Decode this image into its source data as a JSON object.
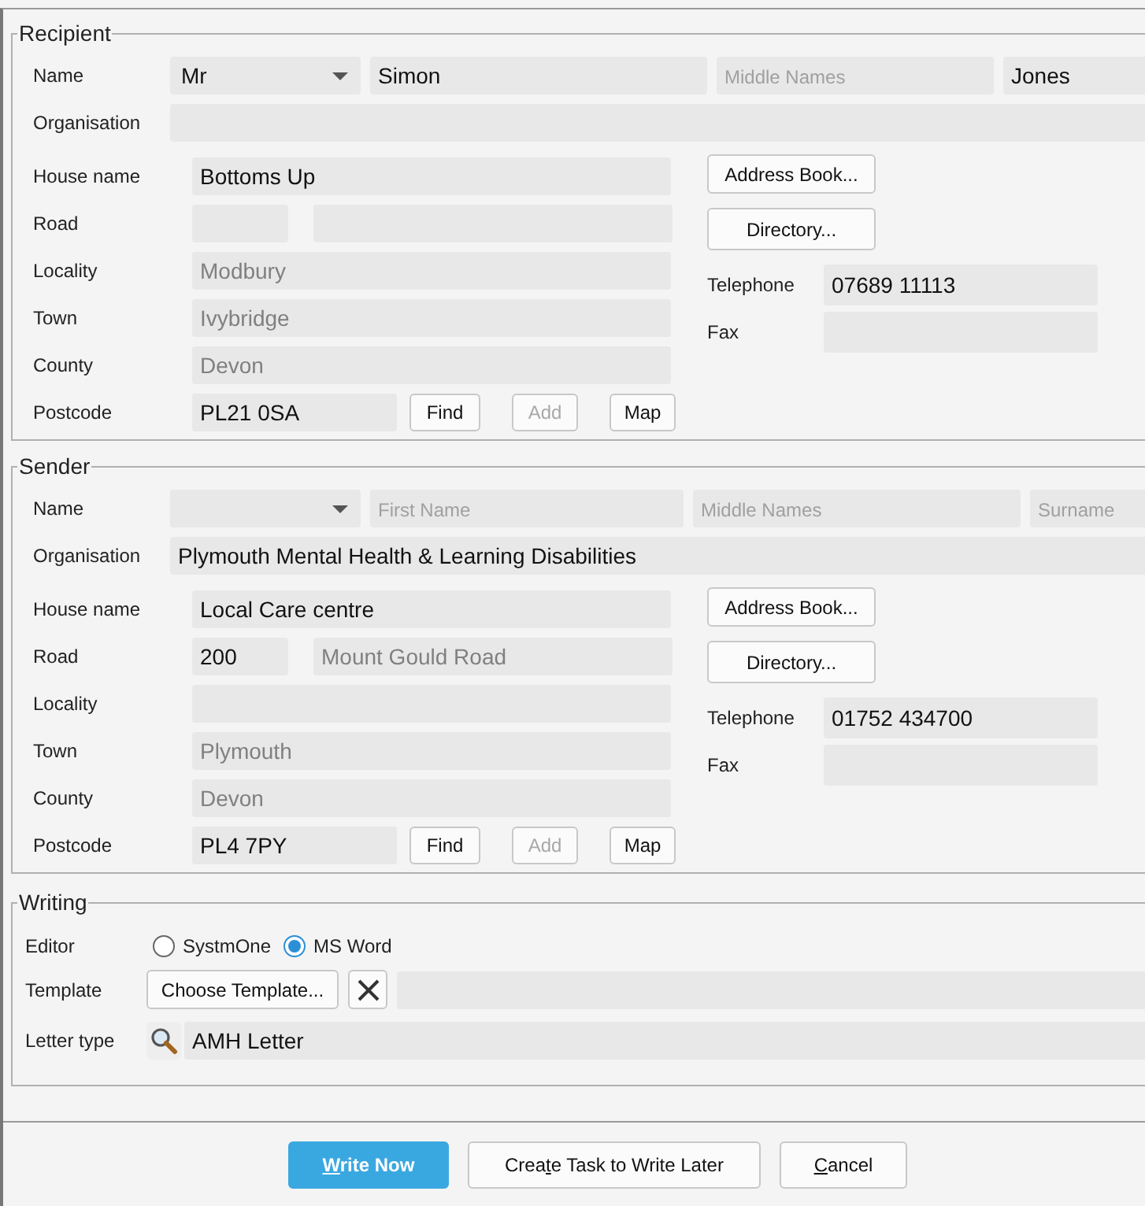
{
  "sections": [
    {
      "legend": "Recipient",
      "name": {
        "label": "Name",
        "title": "Mr",
        "first": {
          "value": "Simon"
        },
        "middle": {
          "placeholder": "Middle Names"
        },
        "surname": {
          "value": "Jones"
        }
      },
      "organisation": {
        "label": "Organisation"
      },
      "house_name": {
        "label": "House name",
        "field": {
          "value": "Bottoms Up"
        }
      },
      "road": {
        "label": "Road"
      },
      "locality": {
        "label": "Locality",
        "field": {
          "value": "Modbury",
          "dimmed": true
        }
      },
      "town": {
        "label": "Town",
        "field": {
          "value": "Ivybridge",
          "dimmed": true
        }
      },
      "county": {
        "label": "County",
        "field": {
          "value": "Devon",
          "dimmed": true
        }
      },
      "postcode": {
        "label": "Postcode",
        "field": {
          "value": "PL21 0SA"
        },
        "buttons": [
          {
            "label": "Find",
            "disabled": false
          },
          {
            "label": "Add",
            "disabled": true
          },
          {
            "label": "Map",
            "disabled": false
          }
        ]
      },
      "address_book": "Address Book...",
      "directory": "Directory...",
      "telephone": {
        "label": "Telephone",
        "field": {
          "value": "07689 11113"
        }
      },
      "fax": {
        "label": "Fax"
      }
    },
    {
      "legend": "Sender",
      "name": {
        "label": "Name",
        "first": {
          "placeholder": "First Name"
        },
        "middle": {
          "placeholder": "Middle Names"
        },
        "surname": {
          "placeholder": "Surname"
        }
      },
      "organisation": {
        "label": "Organisation",
        "field": {
          "value": "Plymouth Mental Health & Learning Disabilities"
        }
      },
      "house_name": {
        "label": "House name",
        "field": {
          "value": "Local Care centre"
        }
      },
      "road": {
        "label": "Road",
        "number": {
          "value": "200"
        },
        "street": {
          "value": "Mount Gould Road",
          "dimmed": true
        }
      },
      "locality": {
        "label": "Locality"
      },
      "town": {
        "label": "Town",
        "field": {
          "value": "Plymouth",
          "dimmed": true
        }
      },
      "county": {
        "label": "County",
        "field": {
          "value": "Devon",
          "dimmed": true
        }
      },
      "postcode": {
        "label": "Postcode",
        "field": {
          "value": "PL4 7PY"
        },
        "buttons": [
          {
            "label": "Find",
            "disabled": false
          },
          {
            "label": "Add",
            "disabled": true
          },
          {
            "label": "Map",
            "disabled": false
          }
        ]
      },
      "address_book": "Address Book...",
      "directory": "Directory...",
      "telephone": {
        "label": "Telephone",
        "field": {
          "value": "01752 434700"
        }
      },
      "fax": {
        "label": "Fax"
      }
    }
  ],
  "writing": {
    "legend": "Writing",
    "editor": {
      "label": "Editor",
      "options": [
        {
          "label": "SystmOne",
          "selected": false
        },
        {
          "label": "MS Word",
          "selected": true
        }
      ]
    },
    "template": {
      "label": "Template",
      "button": "Choose Template..."
    },
    "letter_type": {
      "label": "Letter type",
      "field": {
        "value": "AMH Letter"
      }
    }
  },
  "footer_buttons": [
    {
      "kind": "primary",
      "key": "W",
      "after": "rite Now"
    },
    {
      "kind": "normal",
      "before": "Crea",
      "key": "t",
      "after": "e Task to Write Later"
    },
    {
      "kind": "normal",
      "key": "C",
      "after": "ancel"
    }
  ]
}
